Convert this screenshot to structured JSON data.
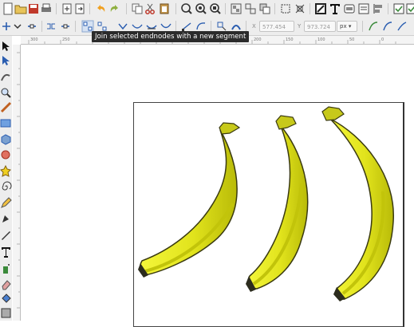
{
  "tooltip": {
    "text": "Join selected endnodes with a new segment"
  },
  "nodebar": {
    "x_label": "X",
    "x_value": "577.454",
    "y_label": "Y",
    "y_value": "973.724",
    "unit": "px"
  },
  "ruler_labels": [
    "300",
    "250",
    "200",
    "150",
    "100",
    "50",
    "0"
  ],
  "colors": {
    "banana_fill": "#e3e51f",
    "banana_shade": "#c2c40a",
    "banana_outline": "#3a3a10",
    "stem": "#c7c91a",
    "tip": "#2c2c1e"
  }
}
